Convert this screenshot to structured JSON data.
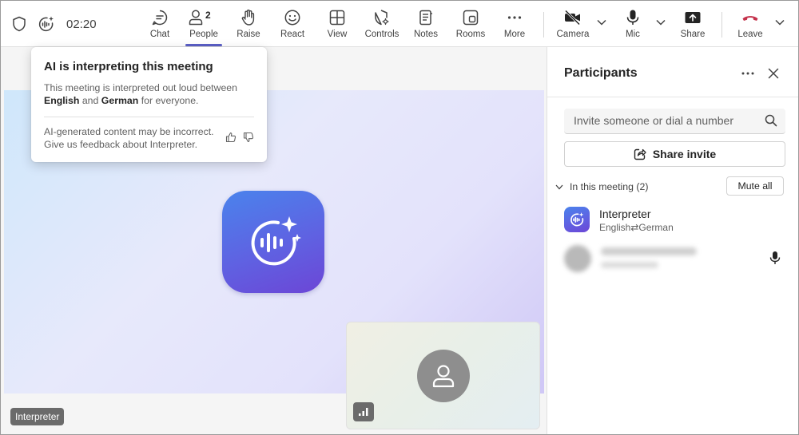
{
  "topbar": {
    "timer": "02:20",
    "people_count": "2",
    "buttons": {
      "chat": "Chat",
      "people": "People",
      "raise": "Raise",
      "react": "React",
      "view": "View",
      "controls": "Controls",
      "notes": "Notes",
      "rooms": "Rooms",
      "more": "More",
      "camera": "Camera",
      "mic": "Mic",
      "share": "Share",
      "leave": "Leave"
    },
    "leave_color": "#c4314b",
    "active_indicator_color": "#5b5fc7"
  },
  "popover": {
    "title": "AI is interpreting this meeting",
    "desc_prefix": "This meeting is interpreted out loud between",
    "lang_a": "English",
    "desc_and": "and",
    "lang_b": "German",
    "desc_suffix": "for everyone.",
    "feedback": "AI-generated content may be incorrect. Give us feedback about Interpreter."
  },
  "stage": {
    "speaker_label": "Interpreter"
  },
  "participants": {
    "title": "Participants",
    "search_placeholder": "Invite someone or dial a number",
    "share_invite": "Share invite",
    "section_label": "In this meeting (2)",
    "mute_all": "Mute all",
    "rows": [
      {
        "name": "Interpreter",
        "lang_from": "English",
        "lang_sep": "⇄",
        "lang_to": "German"
      }
    ]
  }
}
